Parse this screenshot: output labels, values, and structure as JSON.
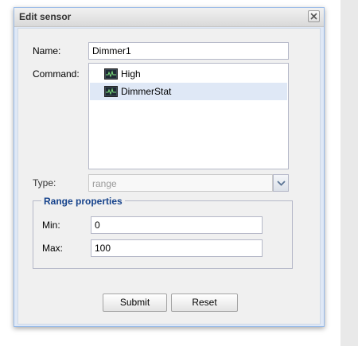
{
  "dialog": {
    "title": "Edit sensor"
  },
  "form": {
    "name_label": "Name:",
    "name_value": "Dimmer1",
    "command_label": "Command:",
    "commands": [
      {
        "label": "High",
        "selected": false,
        "icon": "command-icon"
      },
      {
        "label": "DimmerStat",
        "selected": true,
        "icon": "command-icon"
      }
    ],
    "type_label": "Type:",
    "type_value": "range"
  },
  "range": {
    "legend": "Range properties",
    "min_label": "Min:",
    "min_value": "0",
    "max_label": "Max:",
    "max_value": "100"
  },
  "buttons": {
    "submit": "Submit",
    "reset": "Reset"
  },
  "colors": {
    "accent": "#15428b",
    "selection": "#dfe8f6",
    "border": "#99bbe8"
  }
}
